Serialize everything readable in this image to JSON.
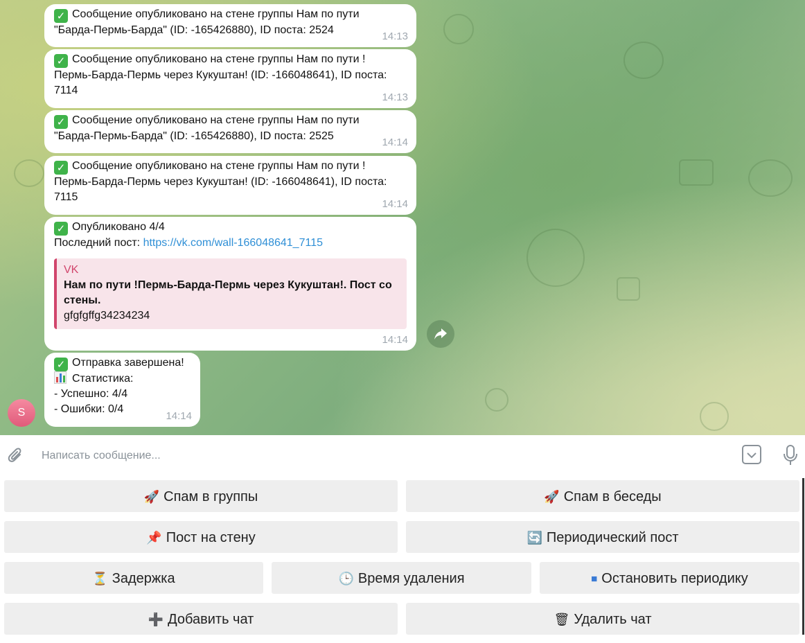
{
  "messages": [
    {
      "lines": [
        "Сообщение опубликовано на стене группы Нам по пути",
        "\"Барда-Пермь-Барда\" (ID: -165426880), ID поста: 2524"
      ],
      "time": "14:13"
    },
    {
      "lines": [
        "Сообщение опубликовано на стене группы Нам по пути !",
        "Пермь-Барда-Пермь через Кукуштан! (ID: -166048641), ID поста:",
        "7114"
      ],
      "time": "14:13"
    },
    {
      "lines": [
        "Сообщение опубликовано на стене группы Нам по пути",
        "\"Барда-Пермь-Барда\" (ID: -165426880), ID поста: 2525"
      ],
      "time": "14:14"
    },
    {
      "lines": [
        "Сообщение опубликовано на стене группы Нам по пути !",
        "Пермь-Барда-Пермь через Кукуштан! (ID: -166048641), ID поста:",
        "7115"
      ],
      "time": "14:14"
    }
  ],
  "published": {
    "line1": "Опубликовано 4/4",
    "last_post_label": "Последний пост: ",
    "last_post_link": "https://vk.com/wall-166048641_7115",
    "preview": {
      "site": "VK",
      "title_line1": "Нам по пути !Пермь-Барда-Пермь через Кукуштан!. Пост со",
      "title_line2": "стены.",
      "text": "gfgfgffg34234234"
    },
    "time": "14:14"
  },
  "final_message": {
    "line1": "Отправка завершена!",
    "line2": "Статистика:",
    "line3": "- Успешно: 4/4",
    "line4": "- Ошибки: 0/4",
    "time": "14:14"
  },
  "avatar_letter": "S",
  "input": {
    "placeholder": "Написать сообщение...",
    "value": ""
  },
  "keyboard": {
    "spam_groups": "Спам в группы",
    "spam_chats": "Спам в беседы",
    "wall_post": "Пост на стену",
    "periodic_post": "Периодический пост",
    "delay": "Задержка",
    "delete_time": "Время удаления",
    "stop_periodic": "Остановить периодику",
    "add_chat": "Добавить чат",
    "delete_chat": "Удалить чат"
  },
  "icons": {
    "spam_groups": "rocket-icon",
    "spam_chats": "rocket-icon",
    "wall_post": "pushpin-icon",
    "periodic_post": "repeat-icon",
    "delay": "hourglass-icon",
    "delete_time": "clock-icon",
    "stop_periodic": "stop-icon",
    "add_chat": "plus-icon",
    "delete_chat": "trash-icon"
  },
  "colors": {
    "link": "#2f8fd6",
    "quote_accent": "#d1456c",
    "check": "#3fb34a"
  }
}
